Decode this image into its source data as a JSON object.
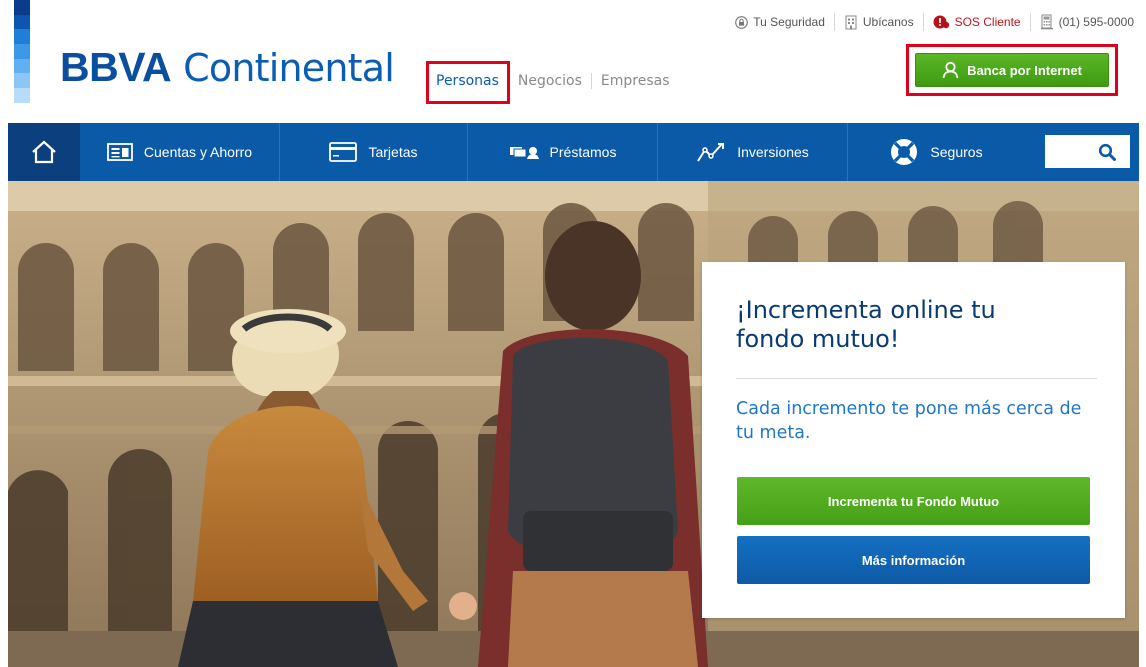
{
  "brand": {
    "name_bold": "BBVA",
    "name_light": "Continental",
    "stripe_colors": [
      "#0b3c8c",
      "#0a56b0",
      "#1f7fd8",
      "#3d99e8",
      "#62b0f0",
      "#8cc6f6",
      "#b7dcf9"
    ]
  },
  "segments": [
    {
      "label": "Personas",
      "active": true
    },
    {
      "label": "Negocios",
      "active": false
    },
    {
      "label": "Empresas",
      "active": false
    }
  ],
  "utility": {
    "security": {
      "label": "Tu Seguridad",
      "icon": "shield-lock-icon"
    },
    "locations": {
      "label": "Ubícanos",
      "icon": "building-icon"
    },
    "sos": {
      "label": "SOS Cliente",
      "icon": "alert-icon"
    },
    "phone": {
      "label": "(01) 595-0000",
      "icon": "phone-building-icon"
    }
  },
  "banca": {
    "label": "Banca por Internet",
    "icon": "user-icon"
  },
  "nav": {
    "home": {
      "icon": "home-icon"
    },
    "items": [
      {
        "label": "Cuentas y Ahorro",
        "icon": "account-icon"
      },
      {
        "label": "Tarjetas",
        "icon": "card-icon"
      },
      {
        "label": "Préstamos",
        "icon": "money-icon"
      },
      {
        "label": "Inversiones",
        "icon": "chart-line-icon"
      },
      {
        "label": "Seguros",
        "icon": "lifebuoy-icon"
      }
    ],
    "search": {
      "icon": "search-icon"
    }
  },
  "promo": {
    "title": "¡Incrementa online tu fondo mutuo!",
    "subtitle": "Cada incremento te pone más cerca de tu meta.",
    "primary_button": "Incrementa tu Fondo Mutuo",
    "secondary_button": "Más información"
  },
  "colors": {
    "brand_blue": "#0a5aa7",
    "nav_home": "#0b3f7e",
    "accent_green": "#4aa71a",
    "highlight_red": "#e0001b",
    "title_navy": "#0a3a73",
    "subtitle_blue": "#1e78c8"
  }
}
